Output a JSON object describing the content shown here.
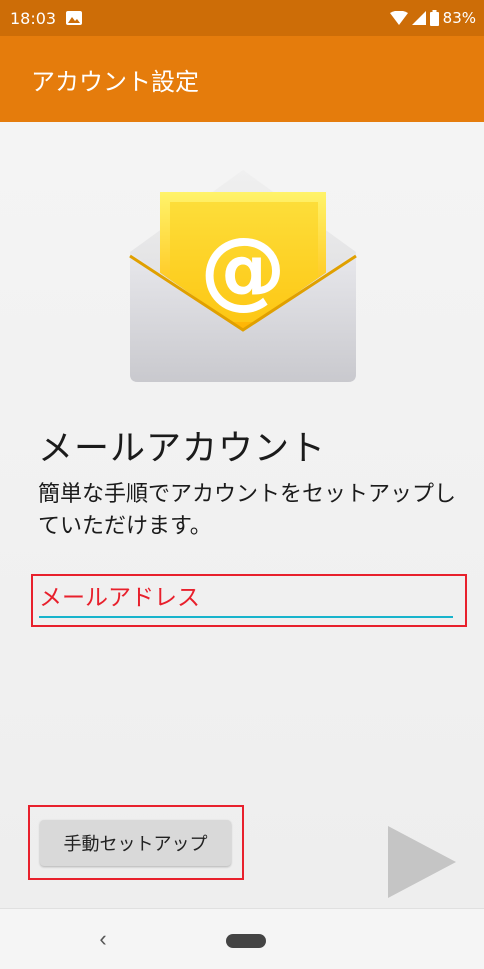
{
  "status_bar": {
    "time": "18:03",
    "battery": "83%",
    "icons": [
      "image-icon",
      "wifi-icon",
      "signal-icon",
      "battery-icon"
    ]
  },
  "app_bar": {
    "title": "アカウント設定"
  },
  "main": {
    "heading": "メールアカウント",
    "subtitle": "簡単な手順でアカウントをセットアップしていただけます。",
    "email_placeholder": "メールアドレス",
    "manual_setup_label": "手動セットアップ",
    "next_icon": "next-arrow-icon"
  },
  "nav_bar": {
    "back_icon": "back-icon",
    "home_icon": "home-pill-icon",
    "back_glyph": "‹"
  },
  "colors": {
    "status_bar": "#cd6d07",
    "app_bar": "#e57c0c",
    "highlight": "#e8202c",
    "underline": "#18b4cc"
  }
}
